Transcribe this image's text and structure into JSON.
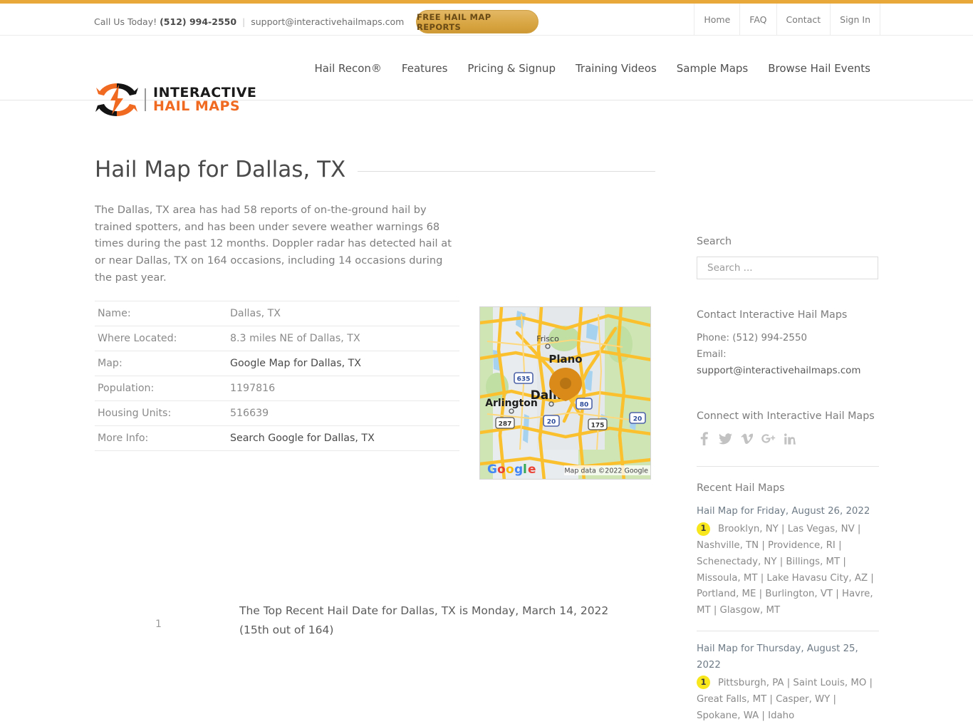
{
  "topbar": {
    "call_prefix": "Call Us Today!",
    "phone": "(512) 994-2550",
    "separator": "|",
    "email": "support@interactivehailmaps.com",
    "cta_label": "FREE HAIL MAP REPORTS",
    "links": [
      {
        "label": "Home"
      },
      {
        "label": "FAQ"
      },
      {
        "label": "Contact"
      },
      {
        "label": "Sign In"
      }
    ]
  },
  "header": {
    "logo_line1": "INTERACTIVE",
    "logo_line2": "HAIL MAPS",
    "nav": [
      {
        "label": "Hail Recon®"
      },
      {
        "label": "Features"
      },
      {
        "label": "Pricing & Signup"
      },
      {
        "label": "Training Videos"
      },
      {
        "label": "Sample Maps"
      },
      {
        "label": "Browse Hail Events"
      }
    ]
  },
  "main": {
    "title": "Hail Map for Dallas, TX",
    "intro": "The Dallas, TX area has had 58 reports of on-the-ground hail by trained spotters, and has been under severe weather warnings 68 times during the past 12 months. Doppler radar has detected hail at or near Dallas, TX on 164 occasions, including 14 occasions during the past year.",
    "table": [
      {
        "key": "Name:",
        "value": "Dallas, TX",
        "is_link": false
      },
      {
        "key": "Where Located:",
        "value": "8.3 miles NE of Dallas, TX",
        "is_link": false
      },
      {
        "key": "Map:",
        "value": "Google Map for Dallas, TX",
        "is_link": true
      },
      {
        "key": "Population:",
        "value": "1197816",
        "is_link": false
      },
      {
        "key": "Housing Units:",
        "value": "516639",
        "is_link": false
      },
      {
        "key": "More Info:",
        "value": "Search Google for Dallas, TX",
        "is_link": true
      }
    ],
    "map": {
      "labels": [
        "Frisco",
        "Plano",
        "Dallas",
        "Arlington"
      ],
      "shields": [
        "635",
        "80",
        "20",
        "287",
        "175",
        "20"
      ],
      "watermark": "Google",
      "attribution": "Map data ©2022 Google"
    },
    "list_number": "1",
    "bottom_note_line1": "The Top Recent Hail Date for Dallas, TX is Monday, March 14, 2022",
    "bottom_note_line2": "(15th out of 164)"
  },
  "sidebar": {
    "search_title": "Search",
    "search_placeholder": "Search ...",
    "search_value": "",
    "contact_title": "Contact Interactive Hail Maps",
    "contact_phone": "Phone: (512) 994-2550",
    "contact_email_label": "Email:",
    "contact_email": "support@interactivehailmaps.com",
    "connect_title": "Connect with Interactive Hail Maps",
    "social": [
      {
        "name": "facebook-icon",
        "glyph": "f"
      },
      {
        "name": "twitter-icon",
        "glyph": "🐦"
      },
      {
        "name": "vimeo-icon",
        "glyph": "v"
      },
      {
        "name": "google-plus-icon",
        "glyph": "g+"
      },
      {
        "name": "linkedin-icon",
        "glyph": "in"
      }
    ],
    "recent_title": "Recent Hail Maps",
    "recent": [
      {
        "date": "Hail Map for Friday, August 26, 2022",
        "count": "1",
        "cities": "Brooklyn, NY | Las Vegas, NV | Nashville, TN | Providence, RI | Schenectady, NY | Billings, MT | Missoula, MT | Lake Havasu City, AZ | Portland, ME | Burlington, VT | Havre, MT | Glasgow, MT"
      },
      {
        "date": "Hail Map for Thursday, August 25, 2022",
        "count": "1",
        "cities": "Pittsburgh, PA | Saint Louis, MO | Great Falls, MT | Casper, WY | Spokane, WA | Idaho"
      }
    ]
  },
  "colors": {
    "gold": "#e8a93a",
    "orange": "#f06a22",
    "badge_yellow": "#f8e71c",
    "text_gray": "#7d7d7d"
  }
}
